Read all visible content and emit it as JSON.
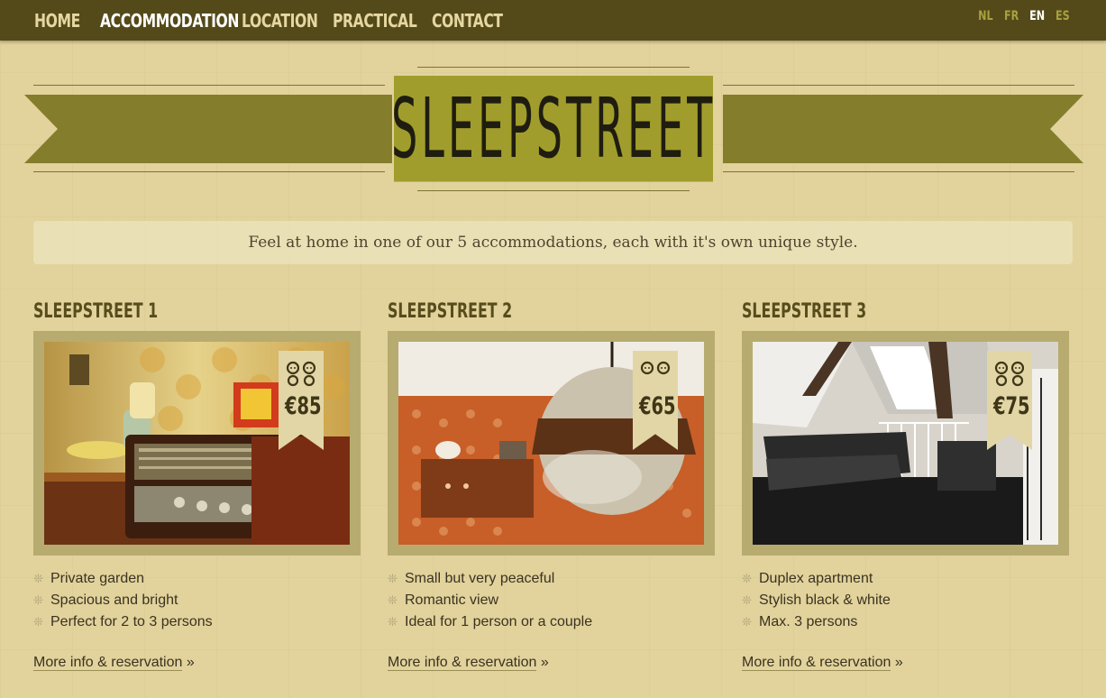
{
  "nav": {
    "items": [
      {
        "label": "HOME"
      },
      {
        "label": "ACCOMMODATION",
        "active": true
      },
      {
        "label": "LOCATION"
      },
      {
        "label": "PRACTICAL"
      },
      {
        "label": "CONTACT"
      }
    ],
    "languages": [
      {
        "label": "NL"
      },
      {
        "label": "FR"
      },
      {
        "label": "EN",
        "active": true
      },
      {
        "label": "ES"
      }
    ]
  },
  "brand": {
    "logo_text": "SLEEPSTREET"
  },
  "intro": {
    "text": "Feel at home in one of our 5 accommodations, each with it's own unique style."
  },
  "accommodations": [
    {
      "title": "SLEEPSTREET 1",
      "price": "€85",
      "features": [
        "Private garden",
        "Spacious and bright",
        "Perfect for 2 to 3 persons"
      ],
      "link_label": "More info & reservation",
      "link_arrow": "»"
    },
    {
      "title": "SLEEPSTREET 2",
      "price": "€65",
      "features": [
        "Small but very peaceful",
        "Romantic view",
        "Ideal for 1 person or a couple"
      ],
      "link_label": "More info & reservation",
      "link_arrow": "»"
    },
    {
      "title": "SLEEPSTREET 3",
      "price": "€75",
      "features": [
        "Duplex apartment",
        "Stylish black & white",
        "Max. 3 persons"
      ],
      "link_label": "More info & reservation",
      "link_arrow": "»"
    }
  ],
  "colors": {
    "topbar": "#544a19",
    "ribbon": "#847d2b",
    "logo_box": "#a09d2c",
    "background": "#e2d29c",
    "frame": "#b7ab6f"
  },
  "icons": {
    "feature_bullet": "flower-bullet-icon",
    "persons": "two-persons-icon"
  }
}
